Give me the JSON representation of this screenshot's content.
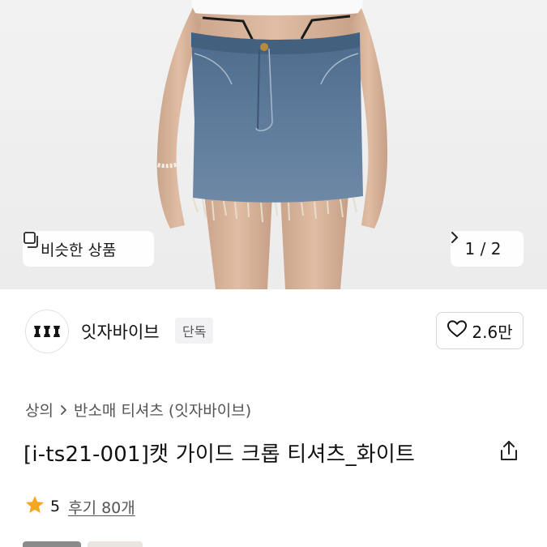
{
  "hero": {
    "similar_label": "비슷한 상품",
    "pager_label": "1 / 2",
    "icons": {
      "similar": "stack-icon",
      "next": "chevron-right-icon"
    }
  },
  "brand": {
    "name": "잇자바이브",
    "badge": "단독",
    "logo_text": "III",
    "like_count": "2.6만",
    "icons": {
      "like": "heart-icon"
    }
  },
  "breadcrumb": {
    "items": [
      "상의",
      "반소매 티셔츠 (잇자바이브)"
    ],
    "icons": {
      "separator": "chevron-right-icon"
    }
  },
  "product": {
    "title": "[i-ts21-001]캣 가이드 크롭 티셔츠_화이트",
    "rating": "5",
    "reviews": "후기 80개",
    "icons": {
      "share": "share-icon",
      "rating": "star-icon"
    },
    "colors": {
      "star": "#F5A623"
    }
  }
}
